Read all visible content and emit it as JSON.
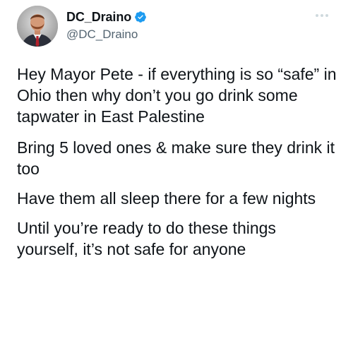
{
  "author": {
    "display_name": "DC_Draino",
    "handle": "@DC_Draino",
    "verified": true,
    "avatar_icon": "person-avatar-icon"
  },
  "menu": {
    "icon": "more-options-icon"
  },
  "tweet": {
    "paragraphs": [
      "Hey Mayor Pete - if everything is so “safe” in Ohio then why don’t you go drink some tapwater in East Palestine",
      "Bring 5 loved ones & make sure they drink it too",
      "Have them all sleep there for a few nights",
      "Until you’re ready to do these things yourself, it’s not safe for anyone"
    ]
  },
  "colors": {
    "text_primary": "#0f1419",
    "text_secondary": "#536471",
    "verified_blue": "#1d9bf0",
    "menu_dots": "#cfd9de"
  }
}
